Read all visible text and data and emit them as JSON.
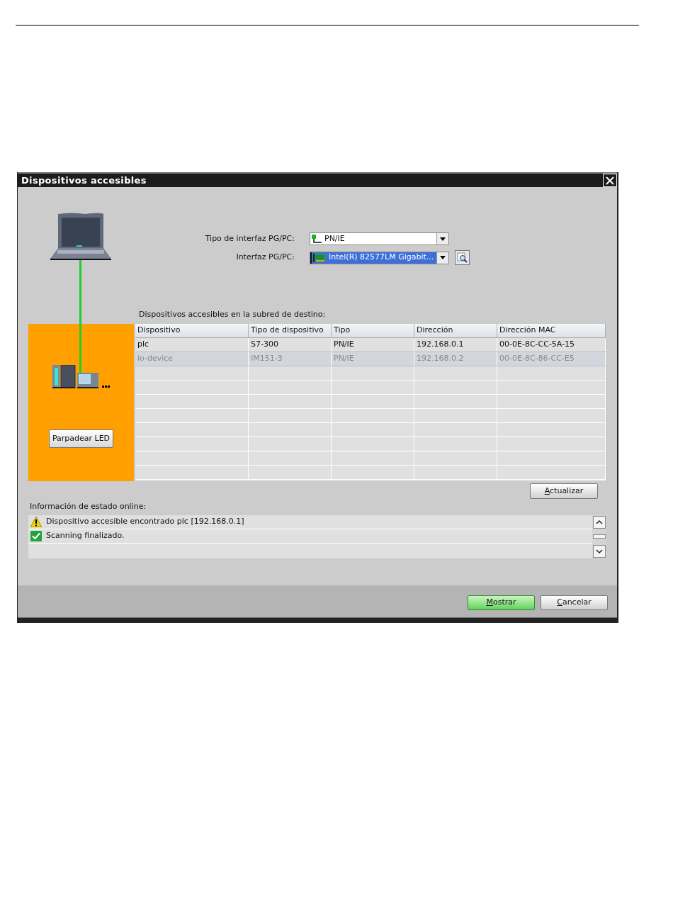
{
  "dialog": {
    "title": "Dispositivos accesibles",
    "interface_fields": [
      {
        "label": "Tipo de interfaz PG/PC:",
        "value": "PN/IE",
        "kind": "network"
      },
      {
        "label": "Interfaz PG/PC:",
        "value": "Intel(R) 82577LM Gigabit...",
        "kind": "adapter"
      }
    ],
    "subnet_caption": "Dispositivos accesibles en la subred de destino:",
    "blink_button": "Parpadear LED",
    "table": {
      "columns": [
        "Dispositivo",
        "Tipo de dispositivo",
        "Tipo",
        "Dirección",
        "Dirección MAC"
      ],
      "rows": [
        {
          "cells": [
            "plc",
            "S7-300",
            "PN/IE",
            "192.168.0.1",
            "00-0E-8C-CC-5A-15"
          ],
          "disabled": false
        },
        {
          "cells": [
            "io-device",
            "IM151-3",
            "PN/IE",
            "192.168.0.2",
            "00-0E-8C-86-CC-E5"
          ],
          "disabled": true
        }
      ]
    },
    "refresh_button": "Actualizar",
    "status_label": "Información de estado online:",
    "status_messages": [
      {
        "kind": "warning",
        "text": "Dispositivo accesible encontrado plc [192.168.0.1]"
      },
      {
        "kind": "success",
        "text": "Scanning finalizado."
      }
    ],
    "buttons": [
      {
        "label": "Mostrar",
        "kind": "primary"
      },
      {
        "label": "Cancelar",
        "kind": "secondary"
      }
    ]
  }
}
